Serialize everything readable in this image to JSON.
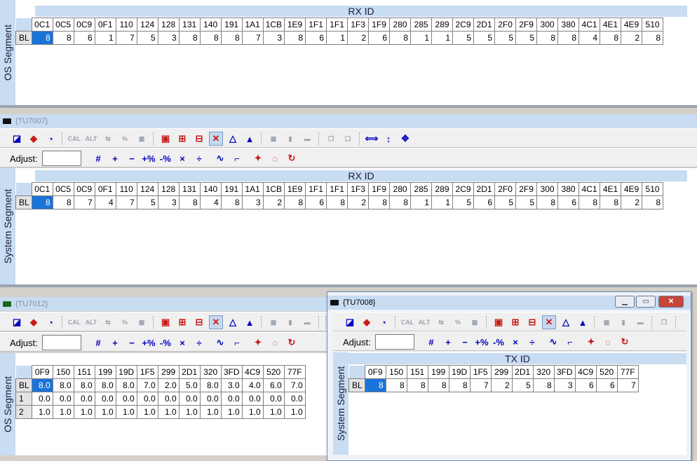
{
  "p1": {
    "side_label": "OS Segment",
    "band": "RX ID",
    "headers": [
      "0C1",
      "0C5",
      "0C9",
      "0F1",
      "110",
      "124",
      "128",
      "131",
      "140",
      "191",
      "1A1",
      "1CB",
      "1E9",
      "1F1",
      "1F1",
      "1F3",
      "1F9",
      "280",
      "285",
      "289",
      "2C9",
      "2D1",
      "2F0",
      "2F9",
      "300",
      "380",
      "4C1",
      "4E1",
      "4E9",
      "510"
    ],
    "row_label": "BL",
    "values": [
      "8",
      "8",
      "6",
      "1",
      "7",
      "5",
      "3",
      "8",
      "8",
      "8",
      "7",
      "3",
      "8",
      "6",
      "1",
      "2",
      "6",
      "8",
      "1",
      "1",
      "5",
      "5",
      "5",
      "5",
      "8",
      "8",
      "4",
      "8",
      "2",
      "8"
    ]
  },
  "w2": {
    "title": "{TU7007}",
    "adjust_label": "Adjust:",
    "side_label": "System Segment",
    "band": "RX ID",
    "headers": [
      "0C1",
      "0C5",
      "0C9",
      "0F1",
      "110",
      "124",
      "128",
      "131",
      "140",
      "191",
      "1A1",
      "1CB",
      "1E9",
      "1F1",
      "1F1",
      "1F3",
      "1F9",
      "280",
      "285",
      "289",
      "2C9",
      "2D1",
      "2F0",
      "2F9",
      "300",
      "380",
      "4C1",
      "4E1",
      "4E9",
      "510"
    ],
    "row_label": "BL",
    "values": [
      "8",
      "8",
      "7",
      "4",
      "7",
      "5",
      "3",
      "8",
      "4",
      "8",
      "3",
      "2",
      "8",
      "6",
      "8",
      "2",
      "8",
      "8",
      "1",
      "1",
      "5",
      "6",
      "5",
      "5",
      "8",
      "6",
      "8",
      "8",
      "2",
      "8"
    ]
  },
  "w3": {
    "title": "{TU7012}",
    "adjust_label": "Adjust:",
    "side_label": "OS Segment",
    "headers": [
      "0F9",
      "150",
      "151",
      "199",
      "19D",
      "1F5",
      "299",
      "2D1",
      "320",
      "3FD",
      "4C9",
      "520",
      "77F"
    ],
    "rows": [
      {
        "label": "BL",
        "values": [
          "8.0",
          "8.0",
          "8.0",
          "8.0",
          "8.0",
          "7.0",
          "2.0",
          "5.0",
          "8.0",
          "3.0",
          "4.0",
          "6.0",
          "7.0"
        ]
      },
      {
        "label": "1",
        "values": [
          "0.0",
          "0.0",
          "0.0",
          "0.0",
          "0.0",
          "0.0",
          "0.0",
          "0.0",
          "0.0",
          "0.0",
          "0.0",
          "0.0",
          "0.0"
        ]
      },
      {
        "label": "2",
        "values": [
          "1.0",
          "1.0",
          "1.0",
          "1.0",
          "1.0",
          "1.0",
          "1.0",
          "1.0",
          "1.0",
          "1.0",
          "1.0",
          "1.0",
          "1.0"
        ]
      }
    ]
  },
  "w4": {
    "title": "{TU7008}",
    "adjust_label": "Adjust:",
    "side_label": "System Segment",
    "band": "TX ID",
    "headers": [
      "0F9",
      "150",
      "151",
      "199",
      "19D",
      "1F5",
      "299",
      "2D1",
      "320",
      "3FD",
      "4C9",
      "520",
      "77F"
    ],
    "row_label": "BL",
    "values": [
      "8",
      "8",
      "8",
      "8",
      "8",
      "7",
      "2",
      "5",
      "8",
      "3",
      "6",
      "6",
      "7"
    ]
  },
  "toolbar_icons": [
    "graph-icon",
    "cube-icon",
    "refresh-icon",
    "cal-icon",
    "alt-icon",
    "shift-icon",
    "percent-icon",
    "percent-table-icon",
    "chip-icon",
    "plus-chip-icon",
    "minus-chip-icon",
    "flag-icon",
    "pyramid-icon",
    "pyramid-alt-icon",
    "grid-icon",
    "bar-icon",
    "dash-icon",
    "copy-icon",
    "paste-icon",
    "horizontal-arrow-icon",
    "vertical-arrow-icon",
    "move-icon"
  ],
  "adjust_icons": [
    "#",
    "+",
    "−",
    "+%",
    "-%",
    "×",
    "÷",
    "∿",
    "⌐",
    "✦",
    "◌",
    "↻"
  ],
  "window_buttons": {
    "minimize": "▁",
    "restore": "▭",
    "close": "✕"
  }
}
